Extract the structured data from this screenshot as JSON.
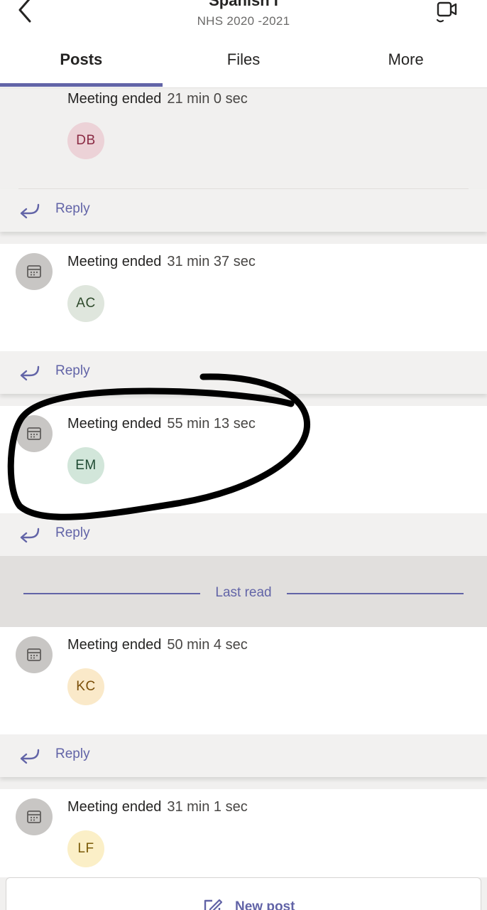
{
  "header": {
    "title": "Spanish I",
    "subtitle": "NHS 2020 -2021",
    "tabs": [
      {
        "label": "Posts",
        "active": true
      },
      {
        "label": "Files",
        "active": false
      },
      {
        "label": "More",
        "active": false
      }
    ]
  },
  "posts": [
    {
      "meeting_label": "Meeting ended",
      "duration": "21 min 0 sec",
      "initials": "DB",
      "avatar_bg": "#ecd2d7",
      "avatar_fg": "#8a2a43",
      "reply_label": "Reply"
    },
    {
      "meeting_label": "Meeting ended",
      "duration": "31 min 37 sec",
      "initials": "AC",
      "avatar_bg": "#dfe6dd",
      "avatar_fg": "#2e4a2b",
      "reply_label": "Reply"
    },
    {
      "meeting_label": "Meeting ended",
      "duration": "55 min 13 sec",
      "initials": "EM",
      "avatar_bg": "#d2e6da",
      "avatar_fg": "#1f4a33",
      "reply_label": "Reply"
    },
    {
      "meeting_label": "Meeting ended",
      "duration": "50 min 4 sec",
      "initials": "KC",
      "avatar_bg": "#fae9c9",
      "avatar_fg": "#7a4e08",
      "reply_label": "Reply"
    },
    {
      "meeting_label": "Meeting ended",
      "duration": "31 min 1 sec",
      "initials": "LF",
      "avatar_bg": "#fbefc7",
      "avatar_fg": "#7a5a06",
      "reply_label": "Reply"
    }
  ],
  "last_read_label": "Last read",
  "new_post_label": "New post",
  "colors": {
    "accent": "#6264a7",
    "background": "#f1f0ef",
    "card": "#ffffff"
  },
  "icons": {
    "back": "chevron-left-icon",
    "video": "video-call-icon",
    "meeting": "calendar-icon",
    "reply": "reply-arrow-icon",
    "compose": "compose-icon"
  }
}
